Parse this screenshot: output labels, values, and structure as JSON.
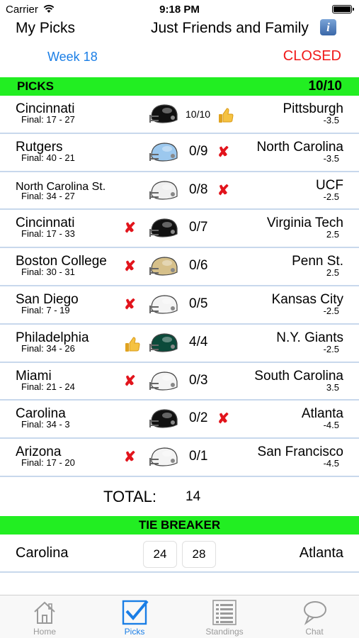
{
  "status_bar": {
    "carrier": "Carrier",
    "time": "9:18 PM"
  },
  "nav": {
    "left_title": "My Picks",
    "center_title": "Just Friends and Family",
    "info_icon": "i"
  },
  "week": {
    "label": "Week 18",
    "status": "CLOSED"
  },
  "picks_header": {
    "label": "PICKS",
    "score": "10/10"
  },
  "games": [
    {
      "home": "Cincinnati",
      "final": "Final: 17 - 27",
      "left_mark": "",
      "helmet_color": "#111111",
      "points": "10/10",
      "right_mark": "thumb",
      "away": "Pittsburgh",
      "spread": "-3.5"
    },
    {
      "home": "Rutgers",
      "final": "Final: 40 - 21",
      "left_mark": "",
      "helmet_color": "#9cc8ee",
      "points": "0/9",
      "right_mark": "x",
      "away": "North Carolina",
      "spread": "-3.5"
    },
    {
      "home": "North Carolina St.",
      "final": "Final: 34 - 27",
      "left_mark": "",
      "helmet_color": "#f0f0f0",
      "points": "0/8",
      "right_mark": "x",
      "away": "UCF",
      "spread": "-2.5"
    },
    {
      "home": "Cincinnati",
      "final": "Final: 17 - 33",
      "left_mark": "x",
      "helmet_color": "#111111",
      "points": "0/7",
      "right_mark": "",
      "away": "Virginia Tech",
      "spread": "2.5"
    },
    {
      "home": "Boston College",
      "final": "Final: 30 - 31",
      "left_mark": "x",
      "helmet_color": "#d6c08a",
      "points": "0/6",
      "right_mark": "",
      "away": "Penn St.",
      "spread": "2.5"
    },
    {
      "home": "San Diego",
      "final": "Final: 7 - 19",
      "left_mark": "x",
      "helmet_color": "#f4f4f4",
      "points": "0/5",
      "right_mark": "",
      "away": "Kansas City",
      "spread": "-2.5"
    },
    {
      "home": "Philadelphia",
      "final": "Final: 34 - 26",
      "left_mark": "thumb",
      "helmet_color": "#0b4a3a",
      "points": "4/4",
      "right_mark": "",
      "away": "N.Y. Giants",
      "spread": "-2.5"
    },
    {
      "home": "Miami",
      "final": "Final: 21 - 24",
      "left_mark": "x",
      "helmet_color": "#f4f4f4",
      "points": "0/3",
      "right_mark": "",
      "away": "South Carolina",
      "spread": "3.5"
    },
    {
      "home": "Carolina",
      "final": "Final: 34 - 3",
      "left_mark": "",
      "helmet_color": "#111111",
      "points": "0/2",
      "right_mark": "x",
      "away": "Atlanta",
      "spread": "-4.5"
    },
    {
      "home": "Arizona",
      "final": "Final: 17 - 20",
      "left_mark": "x",
      "helmet_color": "#f4f4f4",
      "points": "0/1",
      "right_mark": "",
      "away": "San Francisco",
      "spread": "-4.5"
    }
  ],
  "total": {
    "label": "TOTAL:",
    "value": "14"
  },
  "tie_breaker": {
    "label": "TIE BREAKER",
    "home": "Carolina",
    "home_score": "24",
    "away_score": "28",
    "away": "Atlanta"
  },
  "tabs": [
    {
      "label": "Home",
      "icon": "house-icon",
      "active": false
    },
    {
      "label": "Picks",
      "icon": "checkbox-icon",
      "active": true
    },
    {
      "label": "Standings",
      "icon": "list-icon",
      "active": false
    },
    {
      "label": "Chat",
      "icon": "speech-bubble-icon",
      "active": false
    }
  ]
}
